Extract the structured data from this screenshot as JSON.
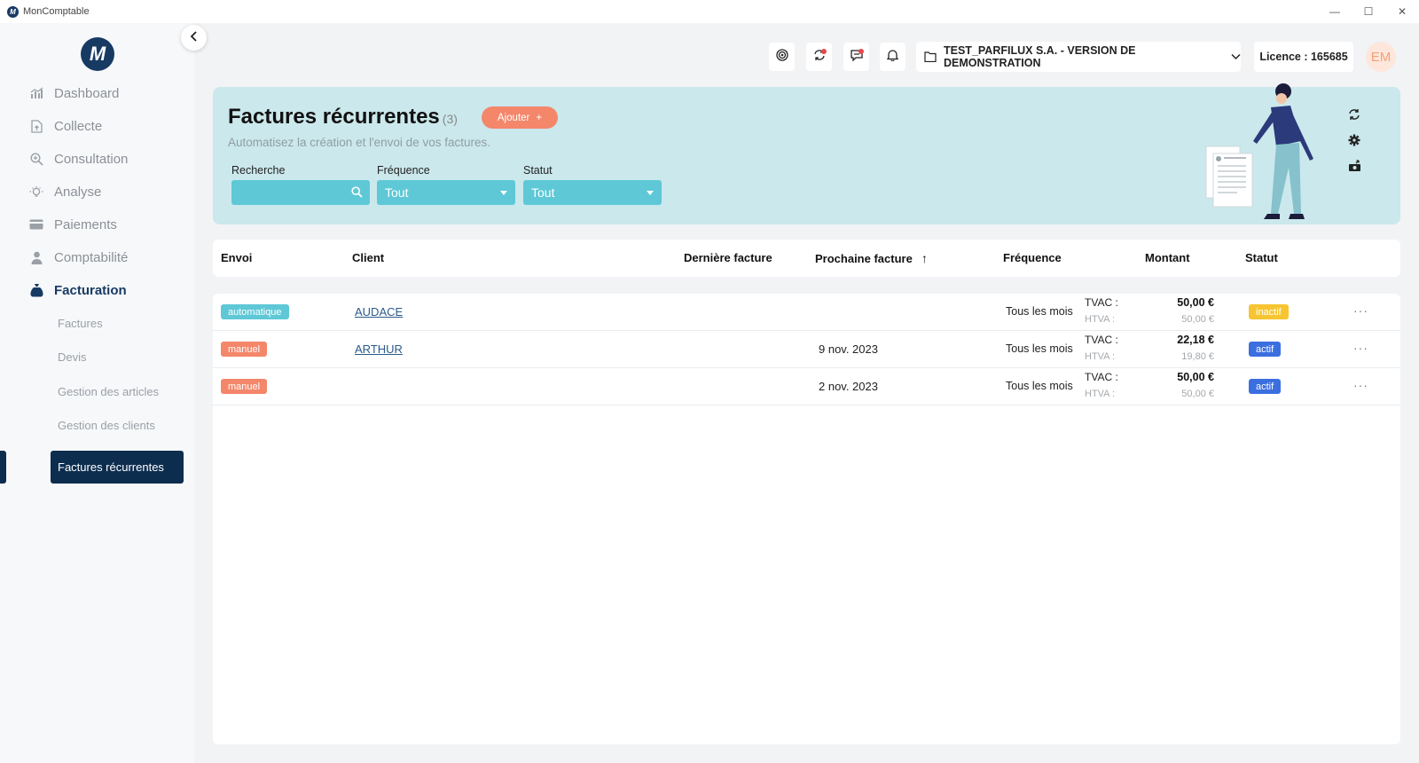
{
  "window": {
    "title": "MonComptable",
    "logo_letter": "M",
    "minimize": "—",
    "maximize": "☐",
    "close": "✕"
  },
  "sidebar": {
    "brand_letter": "M",
    "items": [
      {
        "label": "Dashboard",
        "icon": "chart-icon"
      },
      {
        "label": "Collecte",
        "icon": "upload-file-icon"
      },
      {
        "label": "Consultation",
        "icon": "search-plus-icon"
      },
      {
        "label": "Analyse",
        "icon": "lightbulb-icon"
      },
      {
        "label": "Paiements",
        "icon": "card-icon"
      },
      {
        "label": "Comptabilité",
        "icon": "user-icon"
      },
      {
        "label": "Facturation",
        "icon": "money-bag-icon"
      }
    ],
    "sub_items": [
      "Factures",
      "Devis",
      "Gestion des articles",
      "Gestion des clients"
    ],
    "active_sub_item": "Factures récurrentes"
  },
  "topbar": {
    "company": "TEST_PARFILUX S.A. - VERSION DE DEMONSTRATION",
    "licence": "Licence : 165685",
    "avatar": "EM"
  },
  "hero": {
    "title": "Factures récurrentes",
    "count": "(3)",
    "add_label": "Ajouter",
    "add_plus": "+",
    "subtitle": "Automatisez la création et l'envoi de vos factures.",
    "filters": {
      "search_label": "Recherche",
      "search_value": "",
      "frequency_label": "Fréquence",
      "frequency_value": "Tout",
      "status_label": "Statut",
      "status_value": "Tout"
    }
  },
  "table": {
    "headers": {
      "envoi": "Envoi",
      "client": "Client",
      "derniere": "Dernière facture",
      "prochaine": "Prochaine facture",
      "sort_arrow": "↑",
      "frequence": "Fréquence",
      "montant": "Montant",
      "statut": "Statut"
    },
    "tvac_label": "TVAC :",
    "htva_label": "HTVA :",
    "more": "···",
    "rows": [
      {
        "envoi": "automatique",
        "client": "AUDACE",
        "derniere": "",
        "prochaine": "",
        "frequence": "Tous les mois",
        "tvac": "50,00 €",
        "htva": "50,00 €",
        "statut": "inactif"
      },
      {
        "envoi": "manuel",
        "client": "ARTHUR",
        "derniere": "",
        "prochaine": "9 nov. 2023",
        "frequence": "Tous les mois",
        "tvac": "22,18 €",
        "htva": "19,80 €",
        "statut": "actif"
      },
      {
        "envoi": "manuel",
        "client": "",
        "derniere": "",
        "prochaine": "2 nov. 2023",
        "frequence": "Tous les mois",
        "tvac": "50,00 €",
        "htva": "50,00 €",
        "statut": "actif"
      }
    ]
  },
  "colors": {
    "brand": "#173a63",
    "accent_teal": "#5ec8d6",
    "accent_orange": "#f4866a",
    "status_inactive": "#f7c531",
    "status_active": "#3b6fe0",
    "hero_bg": "#cbe8ec"
  }
}
